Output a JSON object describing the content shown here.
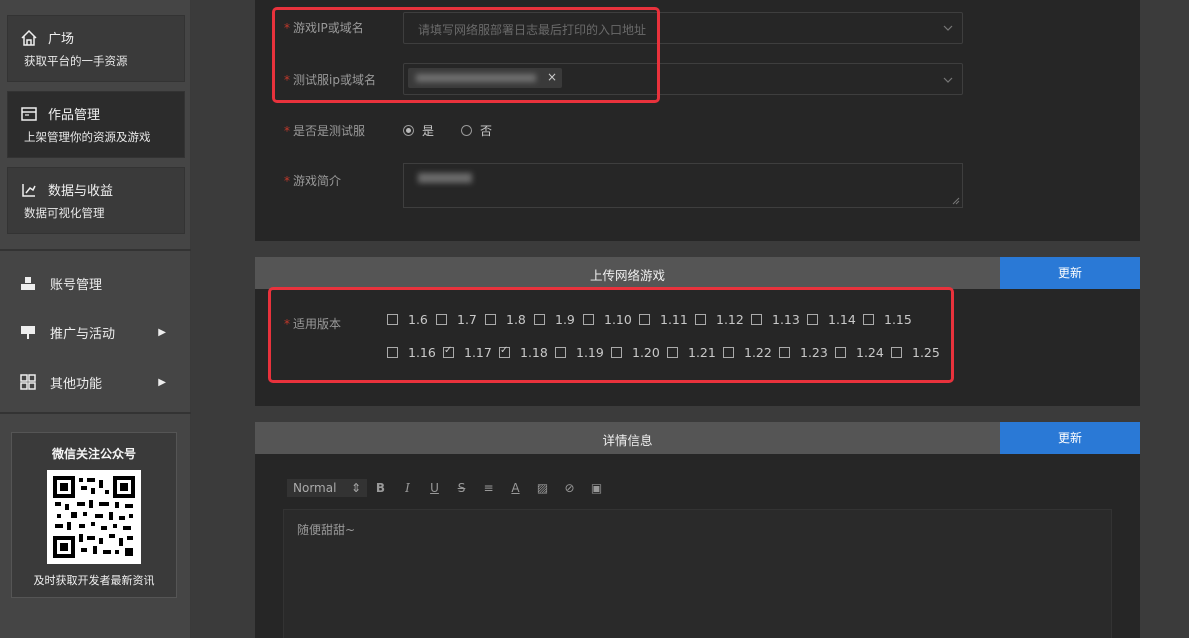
{
  "sidebar": {
    "cards": [
      {
        "title": "广场",
        "sub": "获取平台的一手资源",
        "icon": "home-icon"
      },
      {
        "title": "作品管理",
        "sub": "上架管理你的资源及游戏",
        "icon": "window-icon"
      },
      {
        "title": "数据与收益",
        "sub": "数据可视化管理",
        "icon": "chart-icon"
      }
    ],
    "menu": [
      {
        "label": "账号管理",
        "icon": "account-icon"
      },
      {
        "label": "推广与活动",
        "icon": "promo-icon",
        "arrow": "▶"
      },
      {
        "label": "其他功能",
        "icon": "grid-icon",
        "arrow": "▶"
      }
    ],
    "wechat": {
      "title": "微信关注公众号",
      "footer": "及时获取开发者最新资讯"
    }
  },
  "form": {
    "ip_label": "游戏IP或域名",
    "ip_placeholder": "请填写网络服部署日志最后打印的入口地址",
    "test_ip_label": "测试服ip或域名",
    "test_ip_tag": "",
    "is_test_label": "是否是测试服",
    "is_test_options": [
      "是",
      "否"
    ],
    "is_test_selected": "是",
    "intro_label": "游戏简介",
    "intro_value": ""
  },
  "upload_section": {
    "title": "上传网络游戏",
    "button": "更新",
    "versions_label": "适用版本",
    "versions": [
      "1.6",
      "1.7",
      "1.8",
      "1.9",
      "1.10",
      "1.11",
      "1.12",
      "1.13",
      "1.14",
      "1.15",
      "1.16",
      "1.17",
      "1.18",
      "1.19",
      "1.20",
      "1.21",
      "1.22",
      "1.23",
      "1.24",
      "1.25"
    ],
    "checked": [
      "1.17",
      "1.18"
    ]
  },
  "detail_section": {
    "title": "详情信息",
    "button": "更新",
    "format": "Normal",
    "editor_text": "随便甜甜~"
  },
  "colors": {
    "accent": "#2a79d6",
    "highlight": "#e8323c",
    "required": "#c0392b"
  }
}
